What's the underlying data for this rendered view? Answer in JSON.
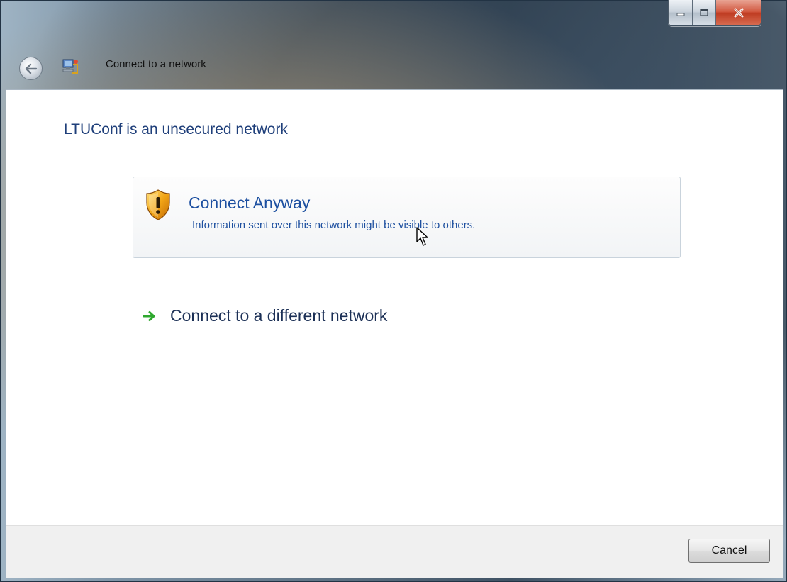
{
  "window": {
    "title": "Connect to a network",
    "icons": {
      "back": "back-arrow-icon",
      "app": "network-connection-icon",
      "minimize": "minimize-icon",
      "maximize": "maximize-icon",
      "close": "close-icon"
    }
  },
  "content": {
    "heading": "LTUConf is an unsecured network",
    "options": [
      {
        "label": "Connect Anyway",
        "description": "Information sent over this network might be visible to others.",
        "icon": "shield-warning-icon"
      },
      {
        "label": "Connect to a different network",
        "icon": "green-arrow-icon"
      }
    ]
  },
  "footer": {
    "cancel_label": "Cancel"
  },
  "colors": {
    "heading": "#1f3f7a",
    "link_blue": "#1c4fa0",
    "close_red": "#c9452b",
    "arrow_green": "#2fa82f"
  }
}
